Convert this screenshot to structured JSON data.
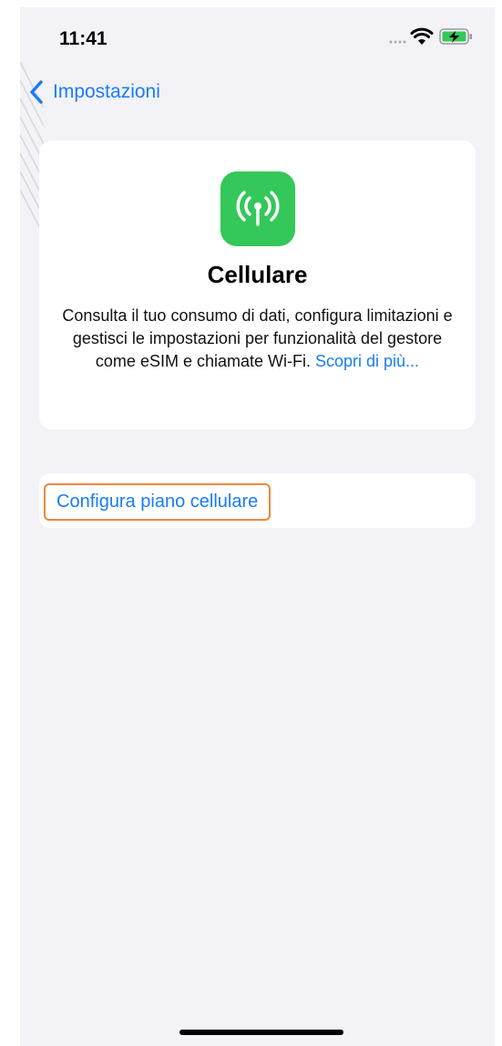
{
  "status_bar": {
    "time": "11:41",
    "icons": [
      "signal-dots-icon",
      "wifi-icon",
      "battery-charging-icon"
    ]
  },
  "nav": {
    "back_label": "Impostazioni",
    "back_icon": "chevron-left-icon"
  },
  "hero": {
    "icon": "antenna-icon",
    "title": "Cellulare",
    "description": "Consulta il tuo consumo di dati, configura limitazioni e gestisci le impostazioni per funzionalità del gestore come eSIM e chiamate Wi-Fi.",
    "link": "Scopri di più..."
  },
  "actions": {
    "setup_plan_label": "Configura piano cellulare"
  },
  "colors": {
    "accent": "#1a7cf5",
    "app_icon": "#34c759",
    "background": "#f2f2f7",
    "focus_outline": "#f0883a",
    "battery_fill": "#34c759"
  }
}
